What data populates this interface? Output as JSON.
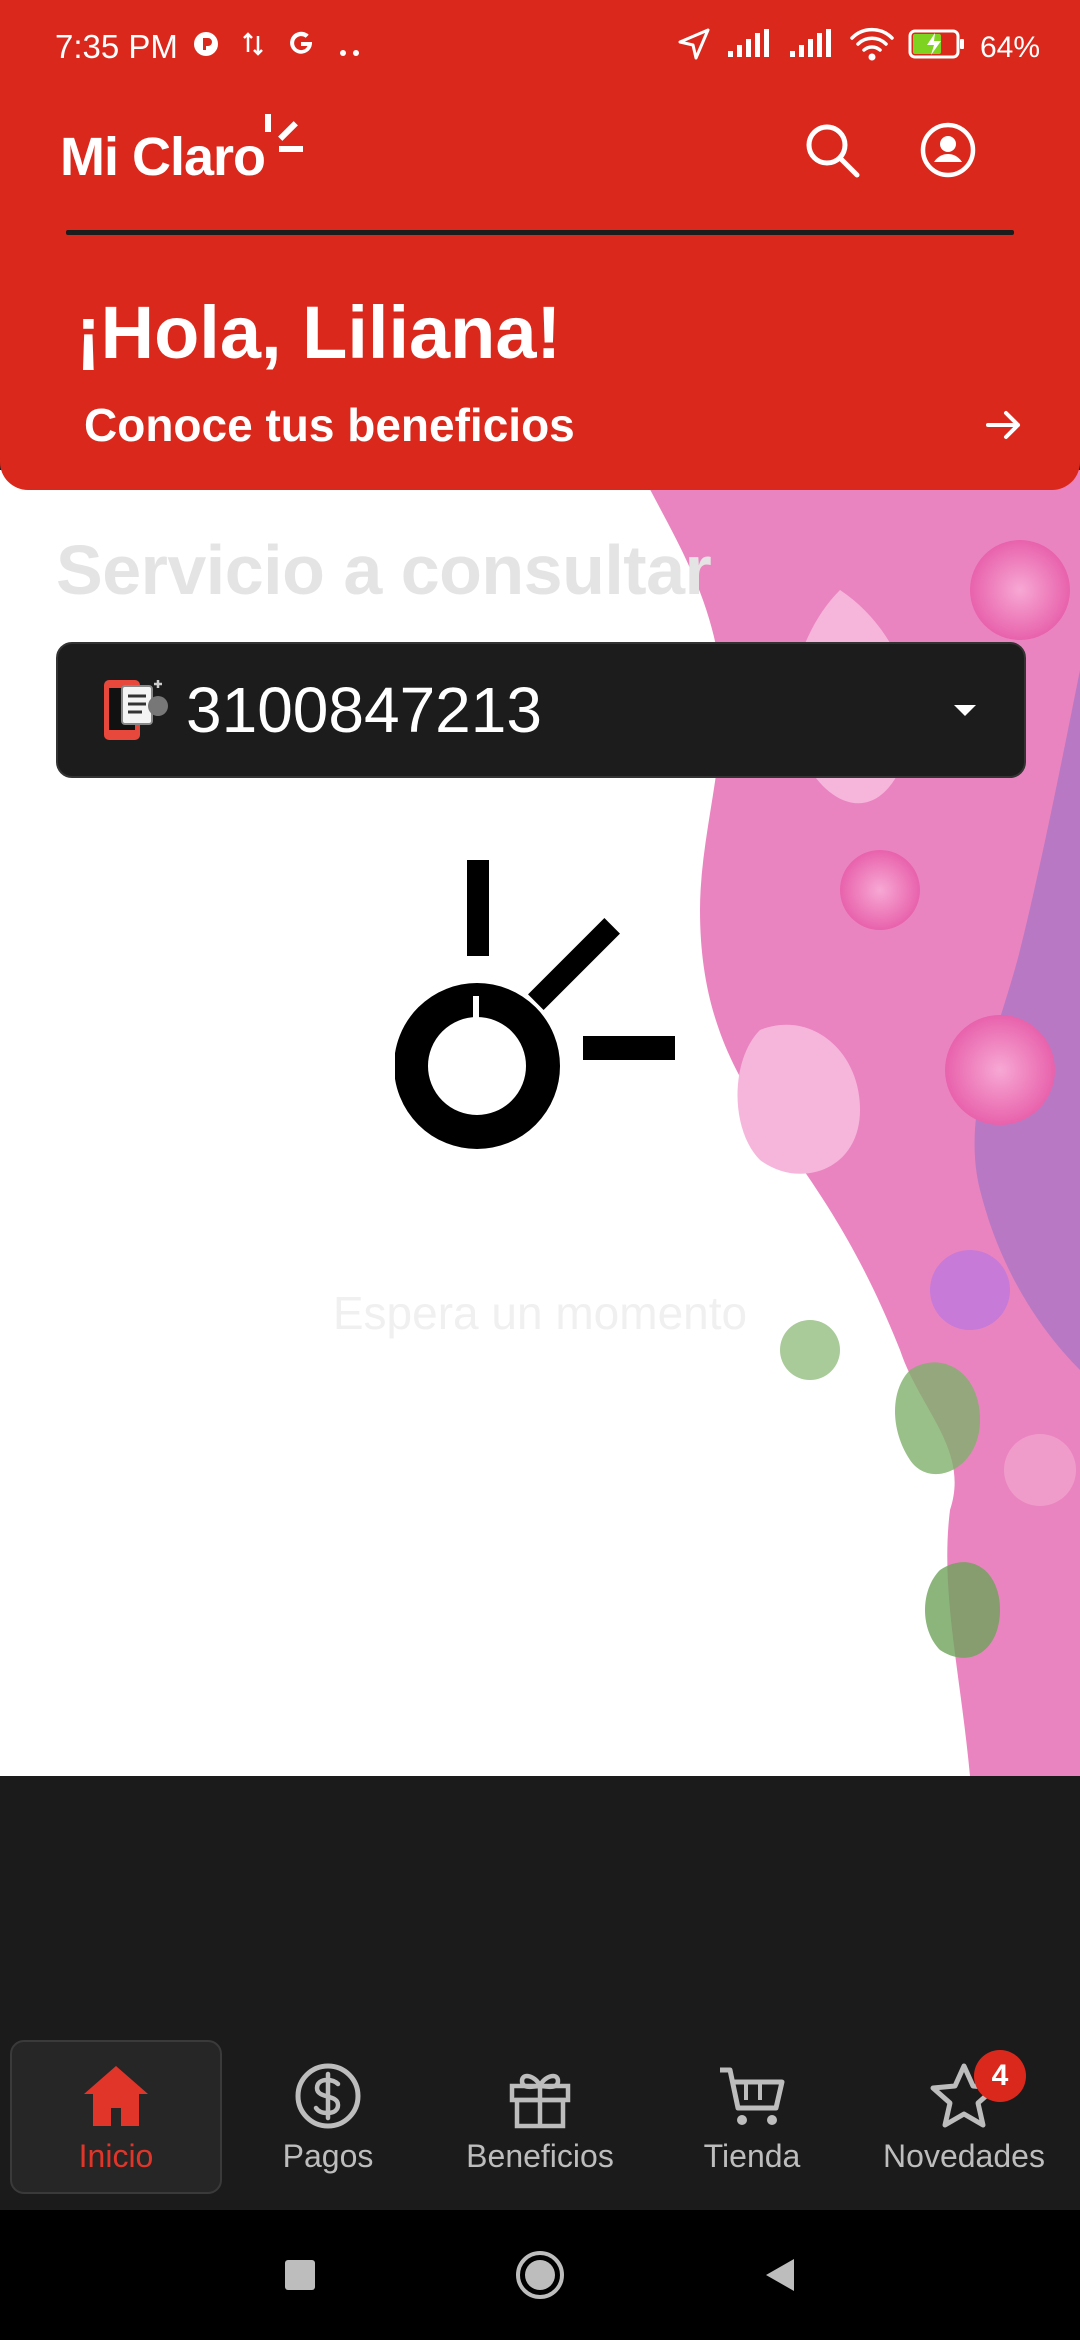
{
  "status_bar": {
    "time": "7:35 PM",
    "battery": "64%",
    "icons": [
      "notification-icon",
      "data-arrows-icon",
      "google-icon",
      "more-dots-icon",
      "location-icon",
      "signal-icon",
      "signal-icon",
      "wifi-icon",
      "battery-charging-icon"
    ]
  },
  "header": {
    "brand": "Mi Claro",
    "greeting": "¡Hola, Liliana!",
    "benefits_link": "Conoce tus beneficios",
    "icons": [
      "search-icon",
      "profile-icon"
    ]
  },
  "service": {
    "label": "Servicio a consultar",
    "number": "3100847213"
  },
  "loading": {
    "message": "Espera un momento"
  },
  "bottom_nav": {
    "items": [
      {
        "label": "Inicio",
        "icon": "home-icon",
        "active": true
      },
      {
        "label": "Pagos",
        "icon": "dollar-icon",
        "active": false
      },
      {
        "label": "Beneficios",
        "icon": "gift-icon",
        "active": false
      },
      {
        "label": "Tienda",
        "icon": "cart-icon",
        "active": false
      },
      {
        "label": "Novedades",
        "icon": "star-icon",
        "active": false,
        "badge": "4"
      }
    ]
  },
  "colors": {
    "brand_red": "#da291c",
    "dark": "#1b1b1b",
    "active_nav": "#e2352a"
  }
}
